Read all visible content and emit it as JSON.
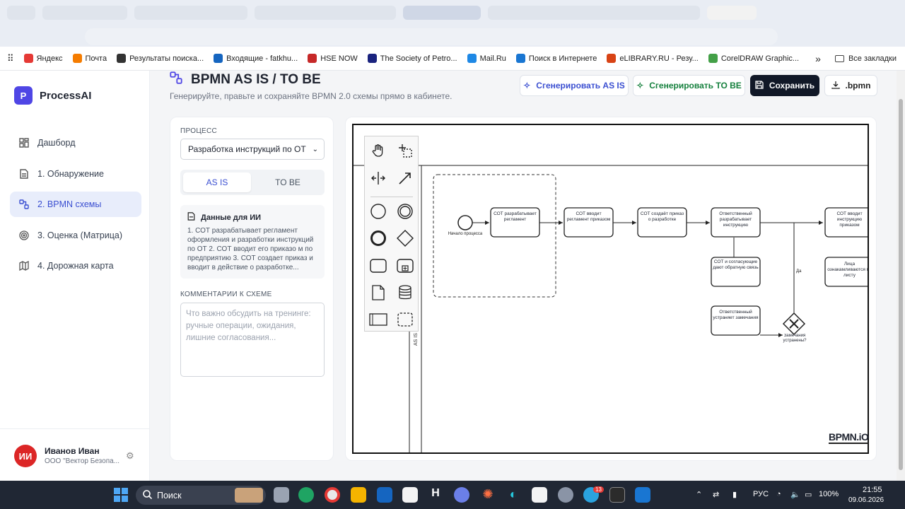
{
  "bookmarks": [
    {
      "label": "Яндекс",
      "color": "#e53935"
    },
    {
      "label": "Почта",
      "color": "#f57c00"
    },
    {
      "label": "Результаты поиска...",
      "color": "#333333"
    },
    {
      "label": "Входящие - fatkhu...",
      "color": "#1565c0"
    },
    {
      "label": "HSE NOW",
      "color": "#c62828"
    },
    {
      "label": "The Society of Petro...",
      "color": "#1a237e"
    },
    {
      "label": "Mail.Ru",
      "color": "#1e88e5"
    },
    {
      "label": "Поиск в Интернете",
      "color": "#1976d2"
    },
    {
      "label": "eLIBRARY.RU - Резу...",
      "color": "#d84315"
    },
    {
      "label": "CorelDRAW Graphic...",
      "color": "#43a047"
    }
  ],
  "bookmarks_more": "»",
  "bookmarks_all": "Все закладки",
  "app": {
    "logo_letter": "P",
    "name": "ProcessAI"
  },
  "nav": [
    {
      "label": "Дашборд",
      "icon": "grid-icon"
    },
    {
      "label": "1. Обнаружение",
      "icon": "document-icon"
    },
    {
      "label": "2. BPMN схемы",
      "icon": "flow-icon"
    },
    {
      "label": "3. Оценка (Матрица)",
      "icon": "target-icon"
    },
    {
      "label": "4. Дорожная карта",
      "icon": "map-icon"
    }
  ],
  "user": {
    "initials": "ИИ",
    "name": "Иванов Иван",
    "org": "ООО \"Вектор Безопа..."
  },
  "header": {
    "title": "BPMN AS IS / TO BE",
    "subtitle": "Генерируйте, правьте и сохраняйте BPMN 2.0 схемы прямо в кабинете.",
    "btn_asis": "Сгенерировать AS IS",
    "btn_tobe": "Сгенерировать TO BE",
    "btn_save": "Сохранить",
    "btn_bpmn": ".bpmn"
  },
  "panel": {
    "process_label": "ПРОЦЕСС",
    "process_value": "Разработка инструкций по ОТ",
    "tab_asis": "AS IS",
    "tab_tobe": "TO BE",
    "ai_title": "Данные для ИИ",
    "ai_text": "1. СОТ разрабатывает регламент оформления и разработки инструкций по ОТ 2. СОТ вводит его приказо м по предприятию 3. СОТ создает приказ и вводит в действие о разработке...",
    "comments_label": "КОММЕНТАРИИ К СХЕМЕ",
    "comments_placeholder": "Что важно обсудить на тренинге: ручные операции, ожидания, лишние согласования..."
  },
  "diagram": {
    "lane_label": "AS IS",
    "start_label": "Начало процесса",
    "tasks": [
      {
        "id": "t1",
        "label": "СОТ разрабатывает регламент"
      },
      {
        "id": "t2",
        "label": "СОТ вводит регламент приказом"
      },
      {
        "id": "t3",
        "label": "СОТ создаёт приказ о разработке"
      },
      {
        "id": "t4",
        "label": "Ответственный разрабатывает инструкцию"
      },
      {
        "id": "t5",
        "label": "СОТ вводит инструкцию приказом"
      },
      {
        "id": "t6",
        "label": "СОТ и согласующие дают обратную связь"
      },
      {
        "id": "t7",
        "label": "Лица ознакамливаются по листу"
      },
      {
        "id": "t8",
        "label": "Ответственный устраняет замечания"
      }
    ],
    "gateway_label": "Замечания устранены?",
    "flow_label": "Да",
    "watermark": "BPMN.iO"
  },
  "taskbar": {
    "search": "Поиск",
    "lang": "РУС",
    "battery": "100%",
    "time": "21:55",
    "date": "09.06.2026",
    "badge": "13"
  }
}
